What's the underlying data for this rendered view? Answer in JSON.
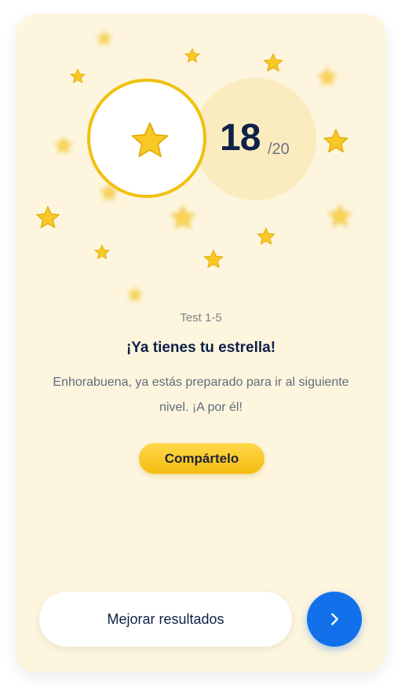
{
  "result": {
    "score": "18",
    "total": "/20"
  },
  "content": {
    "test_label": "Test 1-5",
    "title": "¡Ya tienes tu estrella!",
    "description": "Enhorabuena, ya estás preparado para ir al siguiente nivel. ¡A por él!"
  },
  "actions": {
    "share_label": "Compártelo",
    "improve_label": "Mejorar resultados",
    "next_icon": "chevron-right-icon"
  },
  "colors": {
    "card_background": "#fdf5dd",
    "star_yellow": "#f7c826",
    "ring": "#f0c10f",
    "primary_blue": "#1271ea",
    "text_dark": "#0e2148"
  }
}
